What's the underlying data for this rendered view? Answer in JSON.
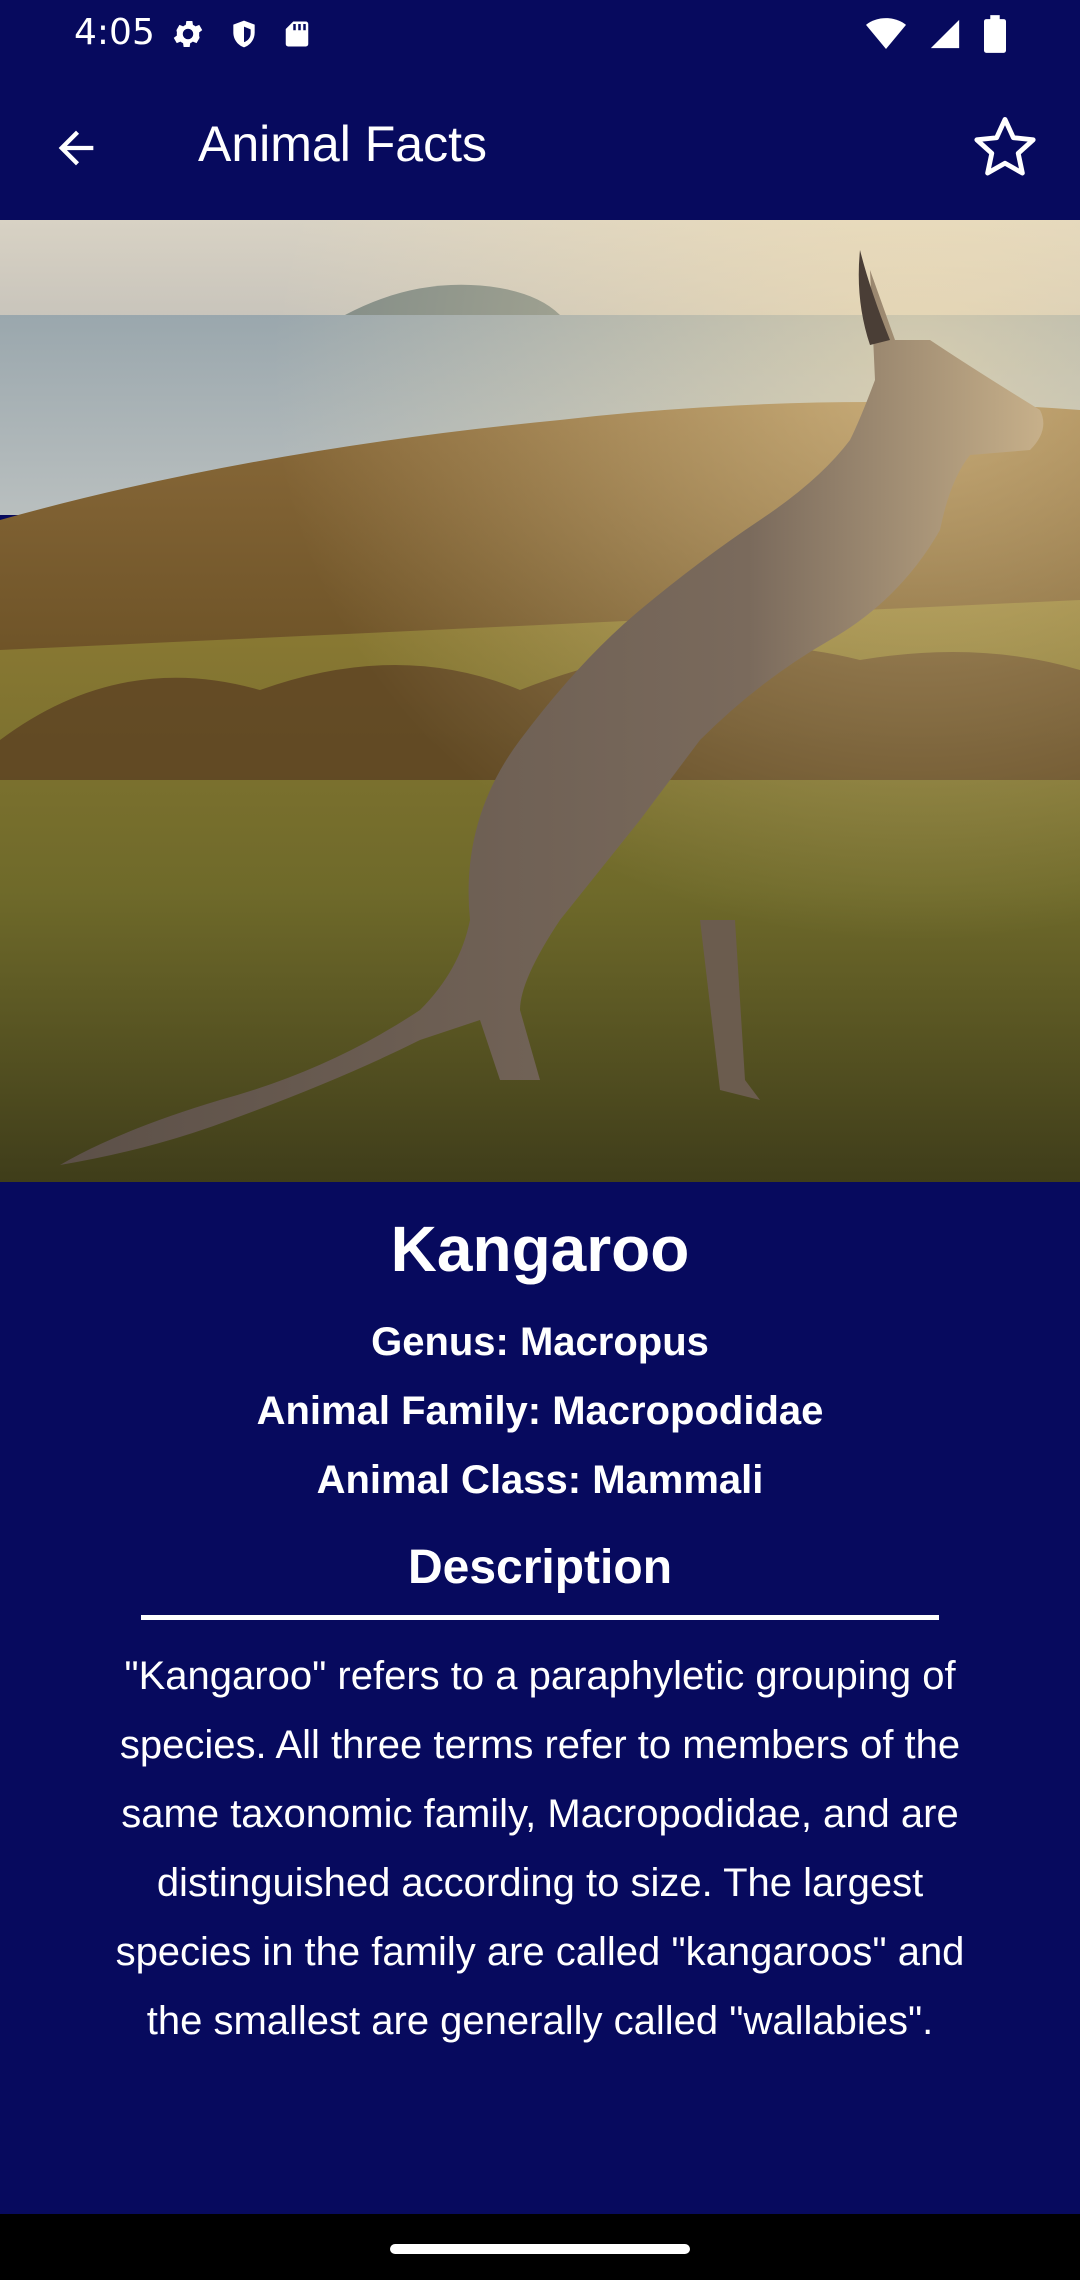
{
  "status_bar": {
    "time": "4:05",
    "left_icons": [
      "settings-icon",
      "shield-icon",
      "sd-card-icon"
    ],
    "right_icons": [
      "wifi-icon",
      "signal-icon",
      "battery-icon"
    ]
  },
  "app_bar": {
    "title": "Animal Facts",
    "back_icon": "arrow-back-icon",
    "favorite_icon": "star-outline-icon"
  },
  "animal": {
    "name": "Kangaroo",
    "genus": "Genus: Macropus",
    "family": "Animal Family: Macropodidae",
    "class": "Animal Class: Mammali"
  },
  "description": {
    "heading": "Description",
    "text": "\"Kangaroo\" refers to a paraphyletic grouping of species. All three terms refer to members of the same taxonomic family, Macropodidae, and are distinguished according to size. The largest species in the family are called \"kangaroos\" and the smallest are generally called \"wallabies\"."
  },
  "colors": {
    "background": "#070a5e",
    "text": "#ffffff",
    "nav_bar": "#000000"
  }
}
